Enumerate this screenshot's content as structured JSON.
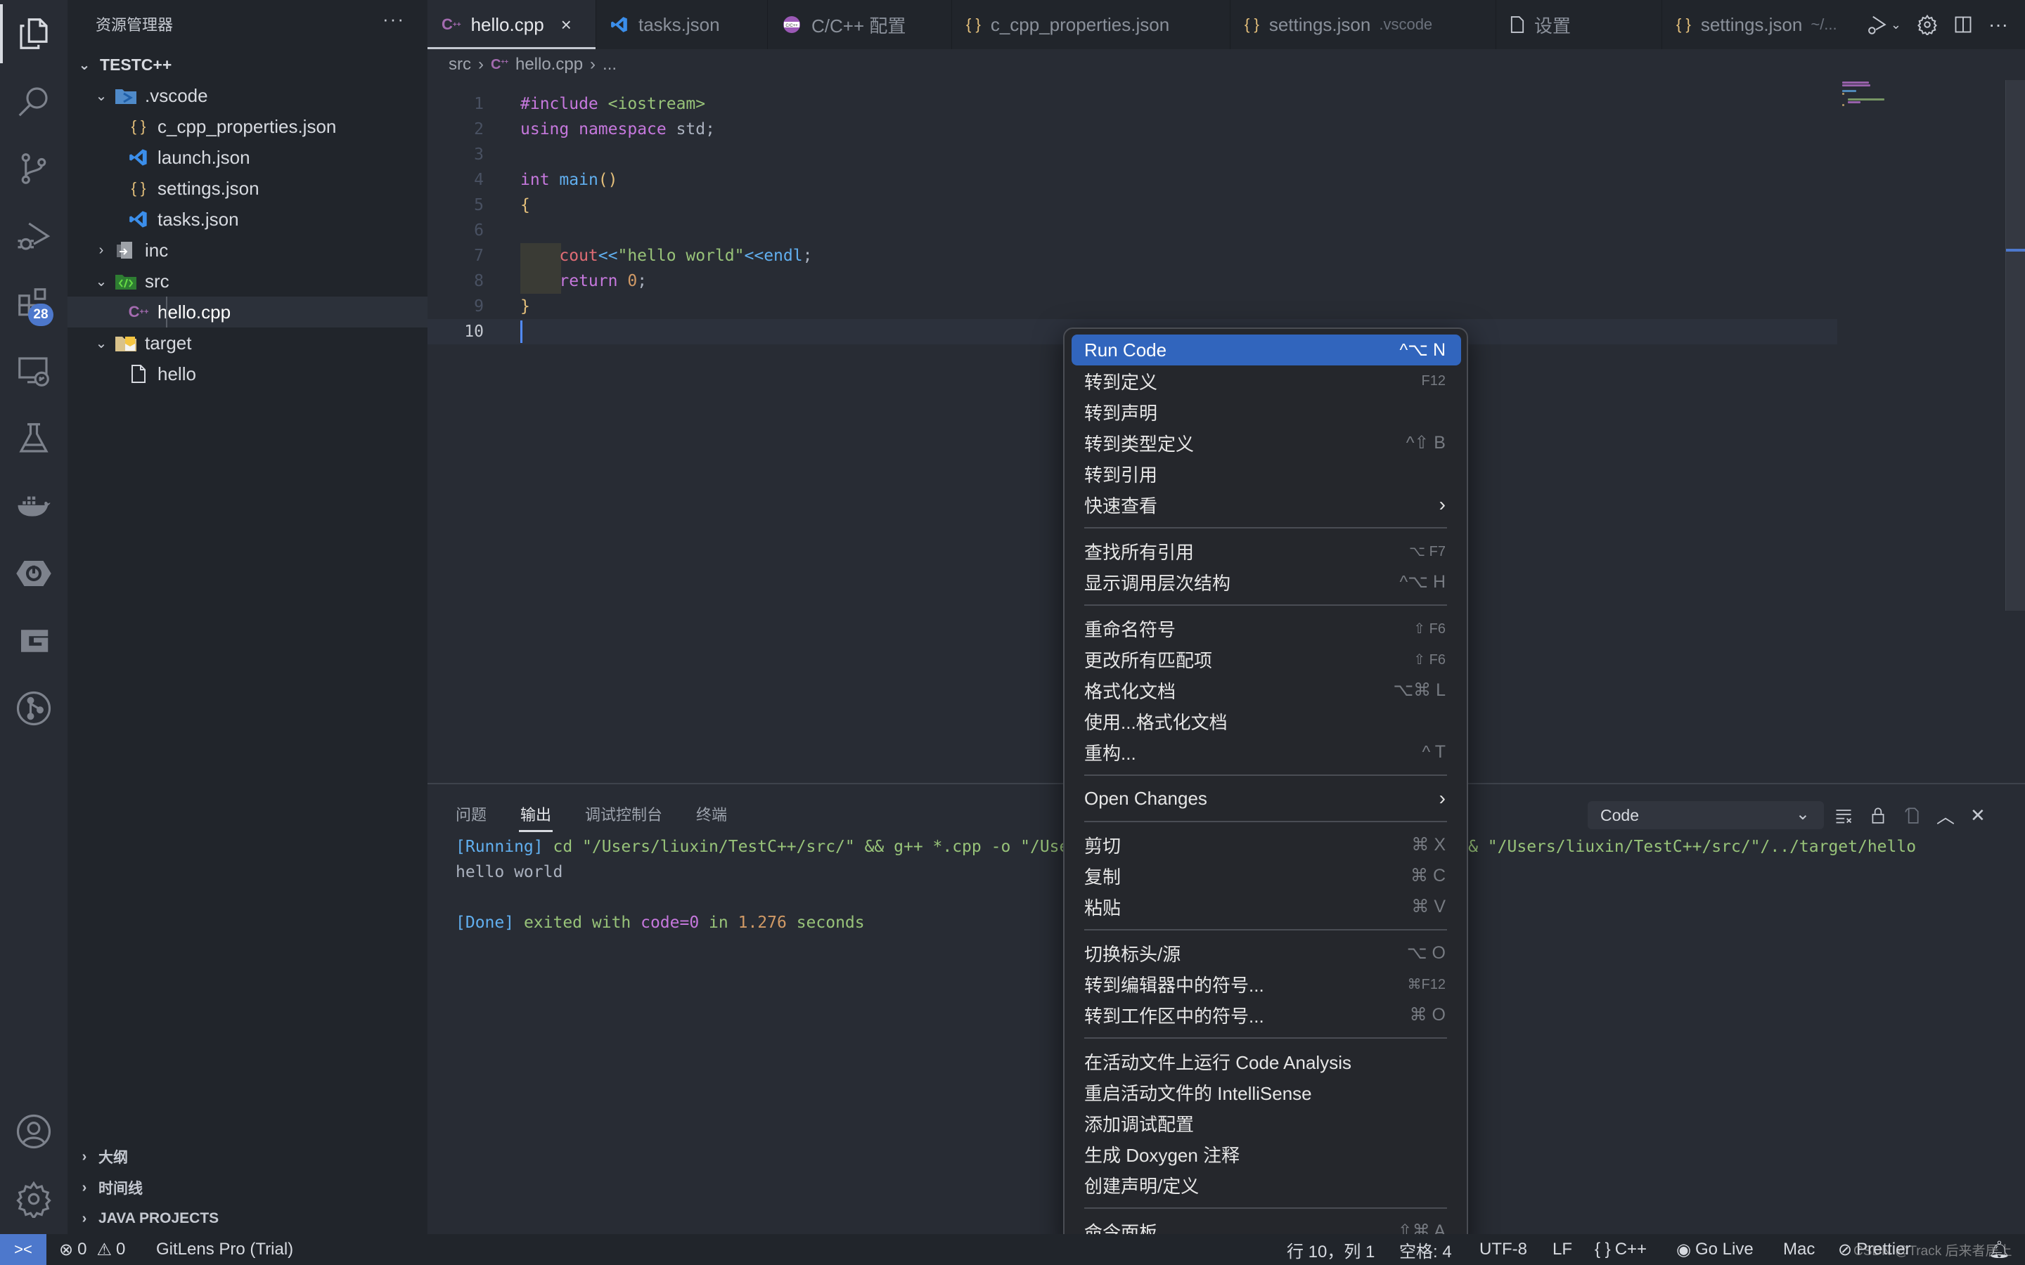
{
  "activity_bar": {
    "items": [
      {
        "name": "explorer",
        "icon": "files-icon",
        "active": true
      },
      {
        "name": "search",
        "icon": "search-icon"
      },
      {
        "name": "source-control",
        "icon": "source-control-icon"
      },
      {
        "name": "run-debug",
        "icon": "run-debug-icon"
      },
      {
        "name": "extensions",
        "icon": "extensions-icon",
        "badge": "28"
      },
      {
        "name": "remote-explorer",
        "icon": "remote-explorer-icon"
      },
      {
        "name": "testing",
        "icon": "flask-icon"
      },
      {
        "name": "docker",
        "icon": "docker-icon"
      },
      {
        "name": "spring-boot",
        "icon": "spring-power-icon"
      },
      {
        "name": "gitlens",
        "icon": "g-logo-icon"
      },
      {
        "name": "git-graph",
        "icon": "git-graph-icon"
      }
    ],
    "bottom": [
      {
        "name": "accounts",
        "icon": "account-icon"
      },
      {
        "name": "manage",
        "icon": "gear-icon"
      }
    ]
  },
  "sidebar": {
    "title": "资源管理器",
    "more": "···",
    "root": "TESTC++",
    "tree": [
      {
        "label": ".vscode",
        "type": "folder",
        "icon": "vscode-folder-icon",
        "expanded": true,
        "depth": 1
      },
      {
        "label": "c_cpp_properties.json",
        "type": "file",
        "icon": "json-braces-icon",
        "depth": 2
      },
      {
        "label": "launch.json",
        "type": "file",
        "icon": "vscode-logo-icon",
        "depth": 2
      },
      {
        "label": "settings.json",
        "type": "file",
        "icon": "json-braces-icon",
        "depth": 2
      },
      {
        "label": "tasks.json",
        "type": "file",
        "icon": "vscode-logo-icon",
        "depth": 2
      },
      {
        "label": "inc",
        "type": "folder",
        "icon": "include-folder-icon",
        "expanded": false,
        "depth": 1
      },
      {
        "label": "src",
        "type": "folder",
        "icon": "src-folder-icon",
        "expanded": true,
        "depth": 1
      },
      {
        "label": "hello.cpp",
        "type": "file",
        "icon": "cpp-file-icon",
        "depth": 2,
        "selected": true
      },
      {
        "label": "target",
        "type": "folder",
        "icon": "target-folder-icon",
        "expanded": true,
        "depth": 1
      },
      {
        "label": "hello",
        "type": "file",
        "icon": "file-icon",
        "depth": 2
      }
    ],
    "sections": [
      "大纲",
      "时间线",
      "JAVA PROJECTS"
    ]
  },
  "tabs": [
    {
      "label": "hello.cpp",
      "icon": "cpp-file-icon",
      "active": true,
      "close": "×"
    },
    {
      "label": "tasks.json",
      "icon": "vscode-logo-icon"
    },
    {
      "label": "C/C++ 配置",
      "icon": "cpp-config-icon"
    },
    {
      "label": "c_cpp_properties.json",
      "icon": "json-braces-icon"
    },
    {
      "label": "settings.json",
      "icon": "json-braces-icon",
      "desc": ".vscode"
    },
    {
      "label": "设置",
      "icon": "file-icon"
    },
    {
      "label": "settings.json",
      "icon": "json-braces-icon",
      "desc": "~/..."
    }
  ],
  "breadcrumb": [
    "src",
    "hello.cpp",
    "..."
  ],
  "editor": {
    "current_line": 10,
    "lines": [
      {
        "n": "1",
        "tokens": [
          {
            "t": "#include",
            "c": "k-purple"
          },
          {
            "t": " ",
            "c": "k-plain"
          },
          {
            "t": "<iostream>",
            "c": "k-green"
          }
        ]
      },
      {
        "n": "2",
        "tokens": [
          {
            "t": "using",
            "c": "k-purple"
          },
          {
            "t": " ",
            "c": "k-plain"
          },
          {
            "t": "namespace",
            "c": "k-purple"
          },
          {
            "t": " std;",
            "c": "k-plain"
          }
        ]
      },
      {
        "n": "3",
        "tokens": []
      },
      {
        "n": "4",
        "tokens": [
          {
            "t": "int",
            "c": "k-purple"
          },
          {
            "t": " ",
            "c": "k-plain"
          },
          {
            "t": "main",
            "c": "k-blue"
          },
          {
            "t": "()",
            "c": "k-yellow"
          }
        ]
      },
      {
        "n": "5",
        "tokens": [
          {
            "t": "{",
            "c": "k-yellow"
          }
        ]
      },
      {
        "n": "6",
        "tokens": []
      },
      {
        "n": "7",
        "indent": true,
        "tokens": [
          {
            "t": "    ",
            "c": "k-plain"
          },
          {
            "t": "cout",
            "c": "k-red"
          },
          {
            "t": "<<",
            "c": "k-blue"
          },
          {
            "t": "\"hello world\"",
            "c": "k-green"
          },
          {
            "t": "<<",
            "c": "k-blue"
          },
          {
            "t": "endl",
            "c": "k-blue"
          },
          {
            "t": ";",
            "c": "k-plain"
          }
        ]
      },
      {
        "n": "8",
        "indent": true,
        "tokens": [
          {
            "t": "    ",
            "c": "k-plain"
          },
          {
            "t": "return",
            "c": "k-purple"
          },
          {
            "t": " ",
            "c": "k-plain"
          },
          {
            "t": "0",
            "c": "k-orange"
          },
          {
            "t": ";",
            "c": "k-plain"
          }
        ]
      },
      {
        "n": "9",
        "tokens": [
          {
            "t": "}",
            "c": "k-yellow"
          }
        ]
      },
      {
        "n": "10",
        "tokens": []
      }
    ]
  },
  "panel": {
    "tabs": [
      "问题",
      "输出",
      "调试控制台",
      "终端"
    ],
    "active_tab": "输出",
    "channel": "Code",
    "output": [
      [
        {
          "t": "[Running]",
          "c": "out-blue"
        },
        {
          "t": " cd \"/Users/liuxin/TestC++/src/\" && g++ *.cpp -o \"/Users/liuxin/TestC++/src/\"/../target/hello && \"/Users/liuxin/TestC++/src/\"/../target/hello",
          "c": "out-green"
        }
      ],
      [
        {
          "t": "hello world",
          "c": ""
        }
      ],
      [],
      [
        {
          "t": "[Done]",
          "c": "out-blue"
        },
        {
          "t": " exited with ",
          "c": "out-green"
        },
        {
          "t": "code=0",
          "c": "out-purple"
        },
        {
          "t": " in ",
          "c": "out-green"
        },
        {
          "t": "1.276",
          "c": "out-orange"
        },
        {
          "t": " seconds",
          "c": "out-green"
        }
      ]
    ]
  },
  "context_menu": {
    "groups": [
      [
        {
          "label": "Run Code",
          "shortcut": "^⌥ N",
          "highlighted": true
        },
        {
          "label": "转到定义",
          "shortcut": "F12",
          "small": true
        },
        {
          "label": "转到声明",
          "shortcut": ""
        },
        {
          "label": "转到类型定义",
          "shortcut": "^⇧ B"
        },
        {
          "label": "转到引用",
          "shortcut": ""
        },
        {
          "label": "快速查看",
          "submenu": true
        }
      ],
      [
        {
          "label": "查找所有引用",
          "shortcut": "⌥ F7",
          "small": true
        },
        {
          "label": "显示调用层次结构",
          "shortcut": "^⌥ H"
        }
      ],
      [
        {
          "label": "重命名符号",
          "shortcut": "⇧ F6",
          "small": true
        },
        {
          "label": "更改所有匹配项",
          "shortcut": "⇧ F6",
          "small": true
        },
        {
          "label": "格式化文档",
          "shortcut": "⌥⌘ L"
        },
        {
          "label": "使用...格式化文档",
          "shortcut": ""
        },
        {
          "label": "重构...",
          "shortcut": "^ T"
        }
      ],
      [
        {
          "label": "Open Changes",
          "submenu": true
        }
      ],
      [
        {
          "label": "剪切",
          "shortcut": "⌘ X"
        },
        {
          "label": "复制",
          "shortcut": "⌘ C"
        },
        {
          "label": "粘贴",
          "shortcut": "⌘ V"
        }
      ],
      [
        {
          "label": "切换标头/源",
          "shortcut": "⌥ O"
        },
        {
          "label": "转到编辑器中的符号...",
          "shortcut": "⌘F12",
          "small": true
        },
        {
          "label": "转到工作区中的符号...",
          "shortcut": "⌘ O"
        }
      ],
      [
        {
          "label": "在活动文件上运行 Code Analysis",
          "shortcut": ""
        },
        {
          "label": "重启活动文件的 IntelliSense",
          "shortcut": ""
        },
        {
          "label": "添加调试配置",
          "shortcut": ""
        },
        {
          "label": "生成 Doxygen 注释",
          "shortcut": ""
        },
        {
          "label": "创建声明/定义",
          "shortcut": ""
        }
      ],
      [
        {
          "label": "命令面板...",
          "shortcut": "⇧⌘ A"
        }
      ]
    ]
  },
  "statusbar": {
    "remote_icon": "remote-icon",
    "errors": "0",
    "warnings": "0",
    "gitlens": "GitLens Pro (Trial)",
    "position": "行 10，列 1",
    "indent": "空格: 4",
    "encoding": "UTF-8",
    "eol": "LF",
    "language": "C++",
    "golive": "Go Live",
    "platform": "Mac",
    "prettier": "Prettier",
    "watermark": "CSDN @Track 后来者居上"
  }
}
